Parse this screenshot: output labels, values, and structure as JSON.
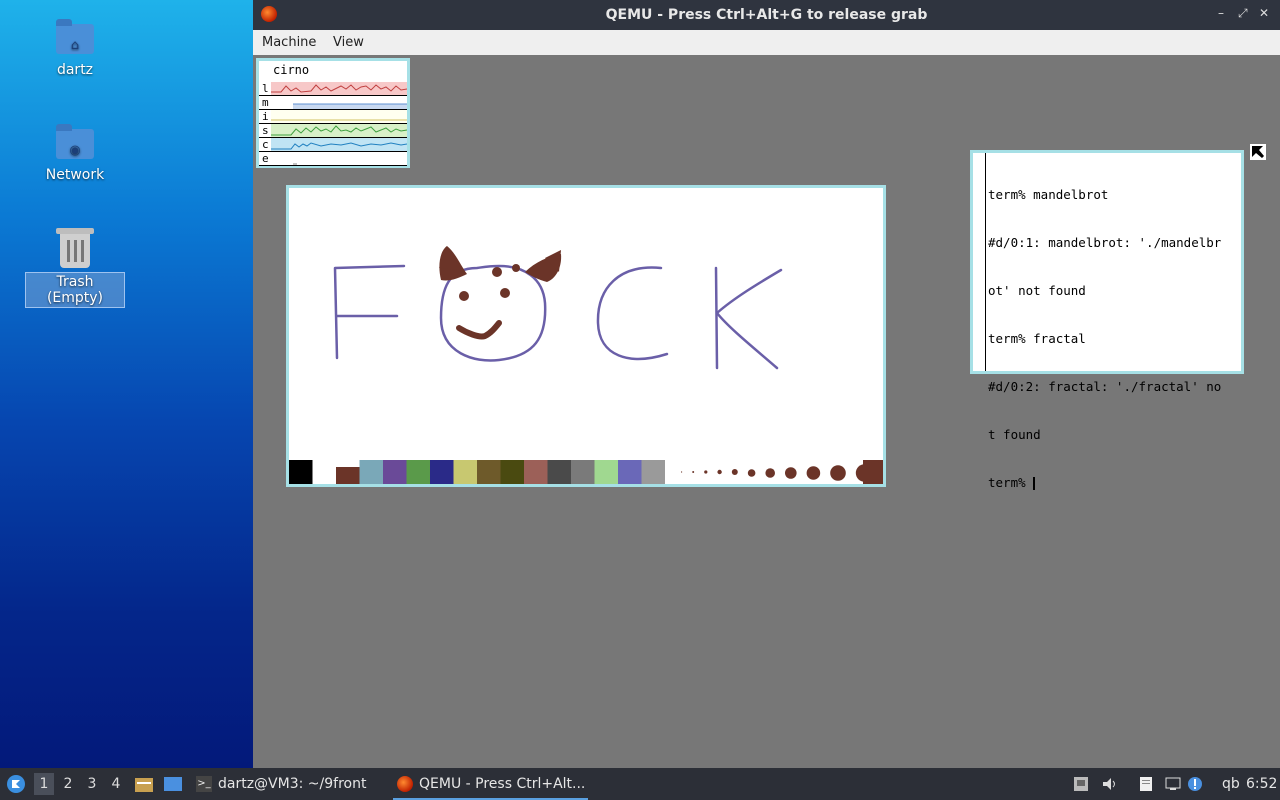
{
  "desktop": {
    "icons": [
      {
        "label": "dartz",
        "icon": "home-folder-icon"
      },
      {
        "label": "Network",
        "icon": "network-folder-icon"
      },
      {
        "label": "Trash (Empty)",
        "icon": "trash-icon"
      }
    ]
  },
  "qemu": {
    "title": "QEMU - Press Ctrl+Alt+G to release grab",
    "menu": [
      "Machine",
      "View"
    ],
    "window_buttons": {
      "minimize": "–",
      "maximize": "⤢",
      "close": "✕"
    }
  },
  "stats": {
    "host": "cirno",
    "rows": [
      "l",
      "m",
      "i",
      "s",
      "c",
      "e"
    ]
  },
  "terminal": {
    "lines": [
      "term% mandelbrot",
      "#d/0:1: mandelbrot: './mandelbr",
      "ot' not found",
      "term% fractal",
      "#d/0:2: fractal: './fractal' no",
      "t found",
      "term% "
    ]
  },
  "paint": {
    "palette_colors": [
      "#000000",
      "#ffffff",
      "#6b3428",
      "#7aa8b8",
      "#6a4a98",
      "#5a9a4a",
      "#2a2a88",
      "#c8c870",
      "#6e5a2a",
      "#4a4a10",
      "#9c6058",
      "#4a4a4a",
      "#7a7a7a",
      "#a0d890",
      "#6a68b8",
      "#9a9a9a"
    ],
    "brush_color": "#6b3428",
    "stroke_color": "#6a5fa8"
  },
  "taskbar": {
    "workspaces": [
      "1",
      "2",
      "3",
      "4"
    ],
    "tasks": [
      {
        "label": "dartz@VM3: ~/9front",
        "icon": "terminal-icon"
      },
      {
        "label": "QEMU - Press Ctrl+Alt...",
        "icon": "qemu-icon"
      }
    ],
    "tray_text": "qb",
    "clock": "6:52"
  }
}
